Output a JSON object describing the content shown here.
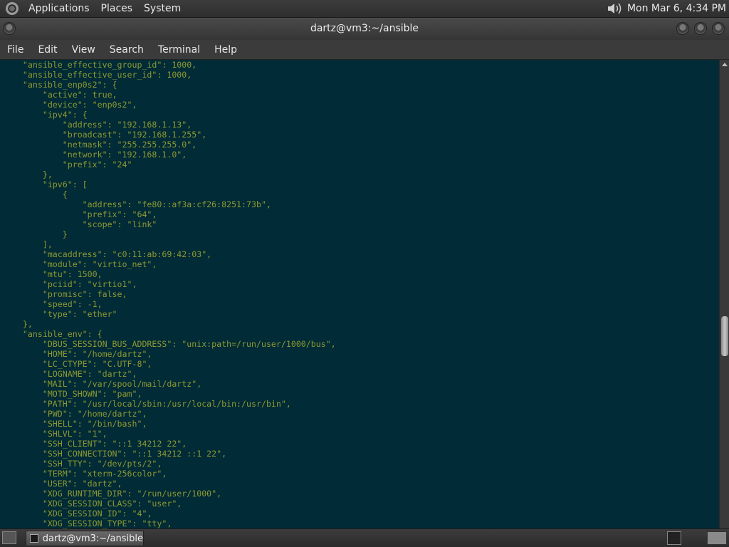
{
  "top_panel": {
    "menus": [
      "Applications",
      "Places",
      "System"
    ],
    "clock": "Mon Mar  6,  4:34 PM"
  },
  "window": {
    "title": "dartz@vm3:~/ansible",
    "menus": [
      "File",
      "Edit",
      "View",
      "Search",
      "Terminal",
      "Help"
    ]
  },
  "terminal": {
    "lines": [
      "    \"ansible_effective_group_id\": 1000,",
      "    \"ansible_effective_user_id\": 1000,",
      "    \"ansible_enp0s2\": {",
      "        \"active\": true,",
      "        \"device\": \"enp0s2\",",
      "        \"ipv4\": {",
      "            \"address\": \"192.168.1.13\",",
      "            \"broadcast\": \"192.168.1.255\",",
      "            \"netmask\": \"255.255.255.0\",",
      "            \"network\": \"192.168.1.0\",",
      "            \"prefix\": \"24\"",
      "        },",
      "        \"ipv6\": [",
      "            {",
      "                \"address\": \"fe80::af3a:cf26:8251:73b\",",
      "                \"prefix\": \"64\",",
      "                \"scope\": \"link\"",
      "            }",
      "        ],",
      "        \"macaddress\": \"c0:11:ab:69:42:03\",",
      "        \"module\": \"virtio_net\",",
      "        \"mtu\": 1500,",
      "        \"pciid\": \"virtio1\",",
      "        \"promisc\": false,",
      "        \"speed\": -1,",
      "        \"type\": \"ether\"",
      "    },",
      "    \"ansible_env\": {",
      "        \"DBUS_SESSION_BUS_ADDRESS\": \"unix:path=/run/user/1000/bus\",",
      "        \"HOME\": \"/home/dartz\",",
      "        \"LC_CTYPE\": \"C.UTF-8\",",
      "        \"LOGNAME\": \"dartz\",",
      "        \"MAIL\": \"/var/spool/mail/dartz\",",
      "        \"MOTD_SHOWN\": \"pam\",",
      "        \"PATH\": \"/usr/local/sbin:/usr/local/bin:/usr/bin\",",
      "        \"PWD\": \"/home/dartz\",",
      "        \"SHELL\": \"/bin/bash\",",
      "        \"SHLVL\": \"1\",",
      "        \"SSH_CLIENT\": \"::1 34212 22\",",
      "        \"SSH_CONNECTION\": \"::1 34212 ::1 22\",",
      "        \"SSH_TTY\": \"/dev/pts/2\",",
      "        \"TERM\": \"xterm-256color\",",
      "        \"USER\": \"dartz\",",
      "        \"XDG_RUNTIME_DIR\": \"/run/user/1000\",",
      "        \"XDG_SESSION_CLASS\": \"user\",",
      "        \"XDG_SESSION_ID\": \"4\",",
      "        \"XDG_SESSION_TYPE\": \"tty\","
    ]
  },
  "taskbar": {
    "task_label": "dartz@vm3:~/ansible"
  },
  "colors": {
    "terminal_bg": "#012b36",
    "terminal_fg": "#8c9a33"
  }
}
